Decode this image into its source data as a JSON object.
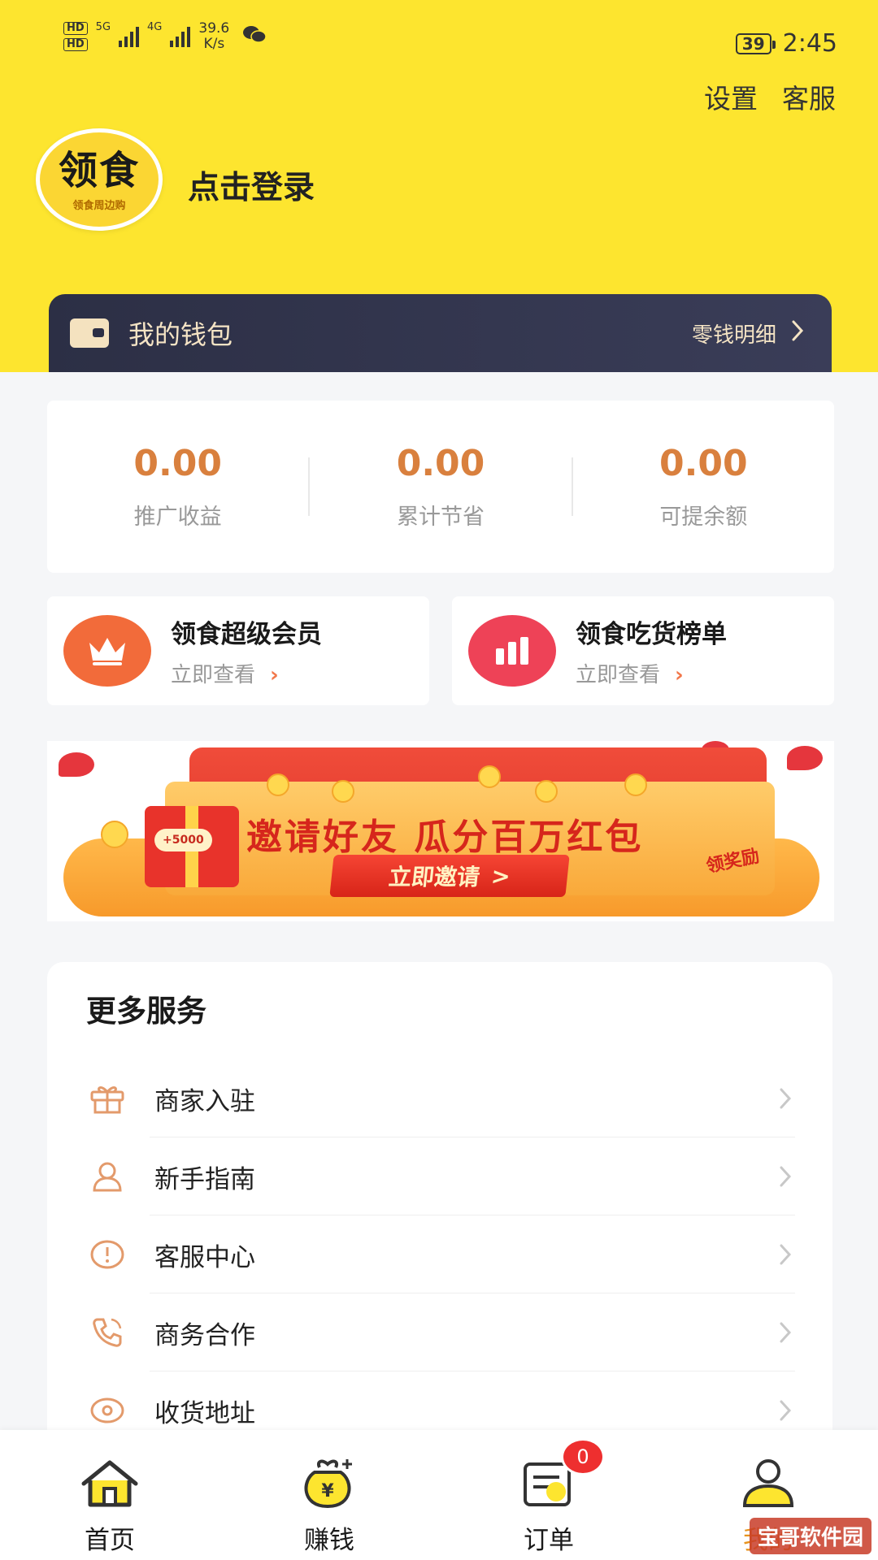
{
  "status_bar": {
    "hd1": "HD",
    "hd2": "HD",
    "sig1": "5G",
    "sig2": "4G",
    "speed_value": "39.6",
    "speed_unit": "K/s",
    "battery": "39",
    "time": "2:45"
  },
  "top_links": {
    "settings": "设置",
    "service": "客服"
  },
  "profile": {
    "logo_main": "领食",
    "logo_sub": "领食周边购",
    "login": "点击登录"
  },
  "wallet": {
    "title": "我的钱包",
    "link": "零钱明细"
  },
  "stats": [
    {
      "value": "0.00",
      "label": "推广收益"
    },
    {
      "value": "0.00",
      "label": "累计节省"
    },
    {
      "value": "0.00",
      "label": "可提余额"
    }
  ],
  "cards": [
    {
      "title": "领食超级会员",
      "sub": "立即查看"
    },
    {
      "title": "领食吃货榜单",
      "sub": "立即查看"
    }
  ],
  "banner": {
    "title": "邀请好友 瓜分百万红包",
    "button": "立即邀请",
    "award": "领奖励",
    "tag": "+5000"
  },
  "services": {
    "title": "更多服务",
    "items": [
      {
        "label": "商家入驻",
        "icon": "gift-icon"
      },
      {
        "label": "新手指南",
        "icon": "user-icon"
      },
      {
        "label": "客服中心",
        "icon": "alert-icon"
      },
      {
        "label": "商务合作",
        "icon": "phone-icon"
      },
      {
        "label": "收货地址",
        "icon": "location-icon"
      }
    ]
  },
  "tabbar": [
    {
      "label": "首页",
      "icon": "home-icon"
    },
    {
      "label": "赚钱",
      "icon": "money-bag-icon"
    },
    {
      "label": "订单",
      "icon": "order-icon",
      "badge": "0"
    },
    {
      "label": "我的",
      "icon": "profile-icon"
    }
  ],
  "watermark": "宝哥软件园",
  "colors": {
    "header": "#fde52f",
    "accent": "#d9803e",
    "wallet_bg": "#2c2f45",
    "active_tab": "#e7931d"
  }
}
